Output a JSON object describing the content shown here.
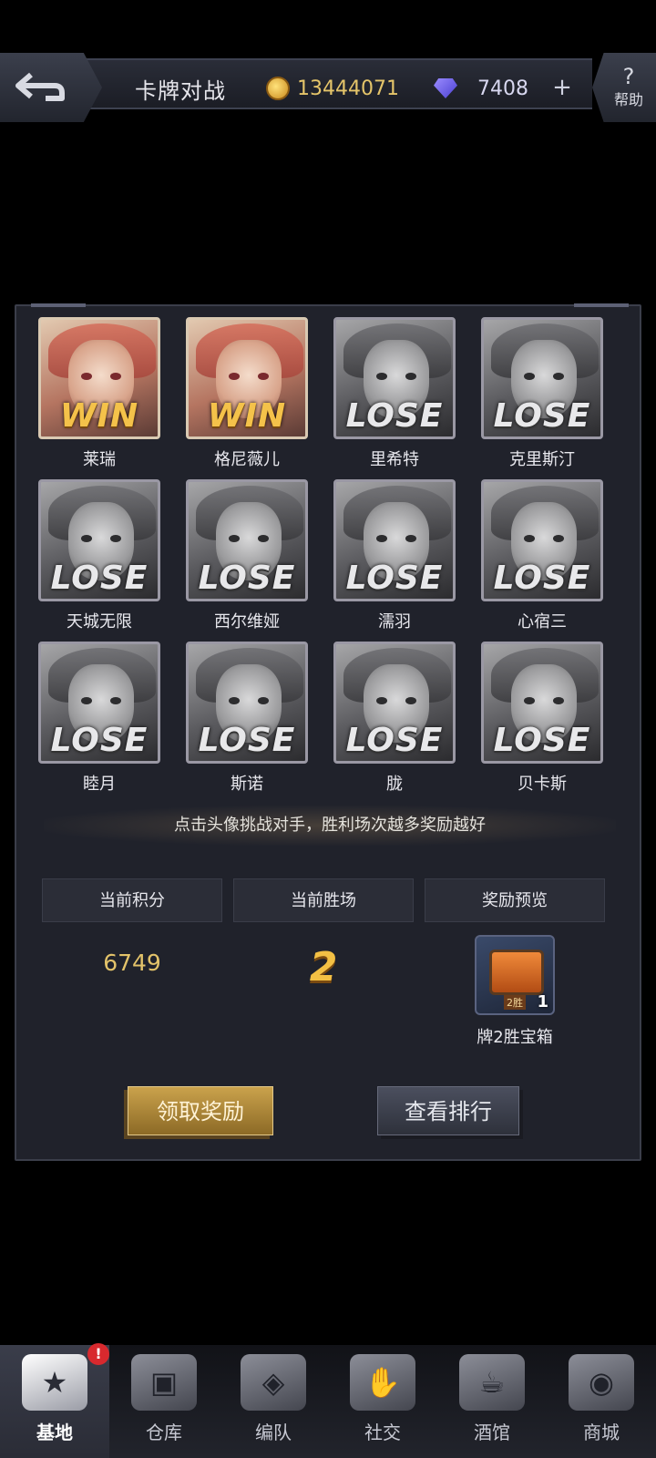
{
  "header": {
    "title": "卡牌对战",
    "gold": "13444071",
    "gems": "7408",
    "plus": "+",
    "help_symbol": "?",
    "help_label": "帮助"
  },
  "opponents": [
    {
      "name": "莱瑞",
      "result": "WIN"
    },
    {
      "name": "格尼薇儿",
      "result": "WIN"
    },
    {
      "name": "里希特",
      "result": "LOSE"
    },
    {
      "name": "克里斯汀",
      "result": "LOSE"
    },
    {
      "name": "天城无限",
      "result": "LOSE"
    },
    {
      "name": "西尔维娅",
      "result": "LOSE"
    },
    {
      "name": "濡羽",
      "result": "LOSE"
    },
    {
      "name": "心宿三",
      "result": "LOSE"
    },
    {
      "name": "睦月",
      "result": "LOSE"
    },
    {
      "name": "斯诺",
      "result": "LOSE"
    },
    {
      "name": "胧",
      "result": "LOSE"
    },
    {
      "name": "贝卡斯",
      "result": "LOSE"
    }
  ],
  "hint": "点击头像挑战对手，胜利场次越多奖励越好",
  "stats": {
    "score_label": "当前积分",
    "wins_label": "当前胜场",
    "reward_label": "奖励预览",
    "score": "6749",
    "wins": "2"
  },
  "reward": {
    "tag": "2胜",
    "quantity": "1",
    "name": "牌2胜宝箱"
  },
  "buttons": {
    "claim": "领取奖励",
    "ranking": "查看排行"
  },
  "nav": {
    "badge": "!",
    "items": [
      {
        "label": "基地",
        "icon": "base-icon"
      },
      {
        "label": "仓库",
        "icon": "warehouse-icon"
      },
      {
        "label": "编队",
        "icon": "formation-icon"
      },
      {
        "label": "社交",
        "icon": "social-icon"
      },
      {
        "label": "酒馆",
        "icon": "tavern-icon"
      },
      {
        "label": "商城",
        "icon": "shop-icon"
      }
    ]
  }
}
